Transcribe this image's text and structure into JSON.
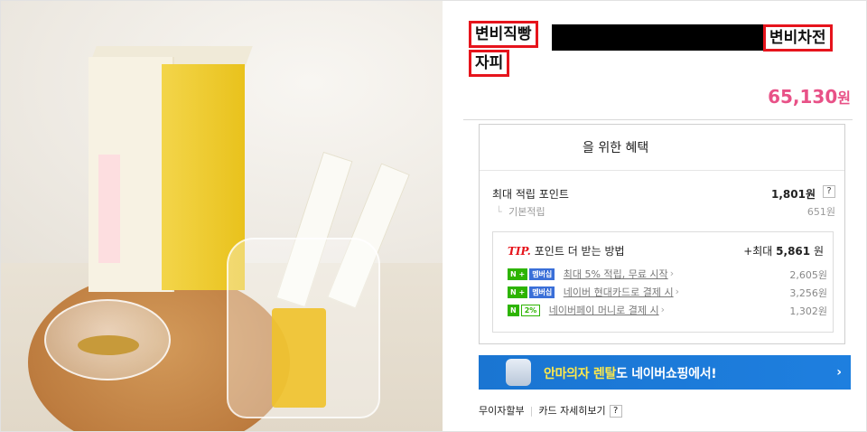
{
  "title": {
    "tag1": "변비직빵",
    "tag2": "변비차전",
    "tag3": "자피"
  },
  "price": {
    "amount": "65,130",
    "unit": "원",
    "color": "#e85187"
  },
  "benefit": {
    "heading": "을 위한 혜택",
    "max_points_label": "최대 적립 포인트",
    "max_points_value": "1,801원",
    "basic_label": "기본적립",
    "basic_value": "651원",
    "help_glyph": "?"
  },
  "tip": {
    "tip_mark": "TIP.",
    "title": "포인트 더 받는 방법",
    "max_prefix": "+최대",
    "max_value": "5,861",
    "max_unit": "원",
    "rows": [
      {
        "badge1": "N +",
        "badge2": "멤버십",
        "text": "최대 5% 적립, 무료 시작",
        "amount": "2,605원"
      },
      {
        "badge1": "N +",
        "badge2": "멤버십",
        "text": "네이버 현대카드로 결제 시",
        "amount": "3,256원"
      },
      {
        "badge1": "N",
        "badge2": "2%",
        "text": "네이버페이 머니로 결제 시",
        "amount": "1,302원"
      }
    ]
  },
  "banner": {
    "highlight": "안마의자 렌탈",
    "rest": "도 네이버쇼핑에서!",
    "arrow": "›",
    "color": "#1a75d2"
  },
  "bottom": {
    "installment": "무이자할부",
    "card_detail": "카드 자세히보기",
    "help_glyph": "?"
  },
  "chevron": "›"
}
